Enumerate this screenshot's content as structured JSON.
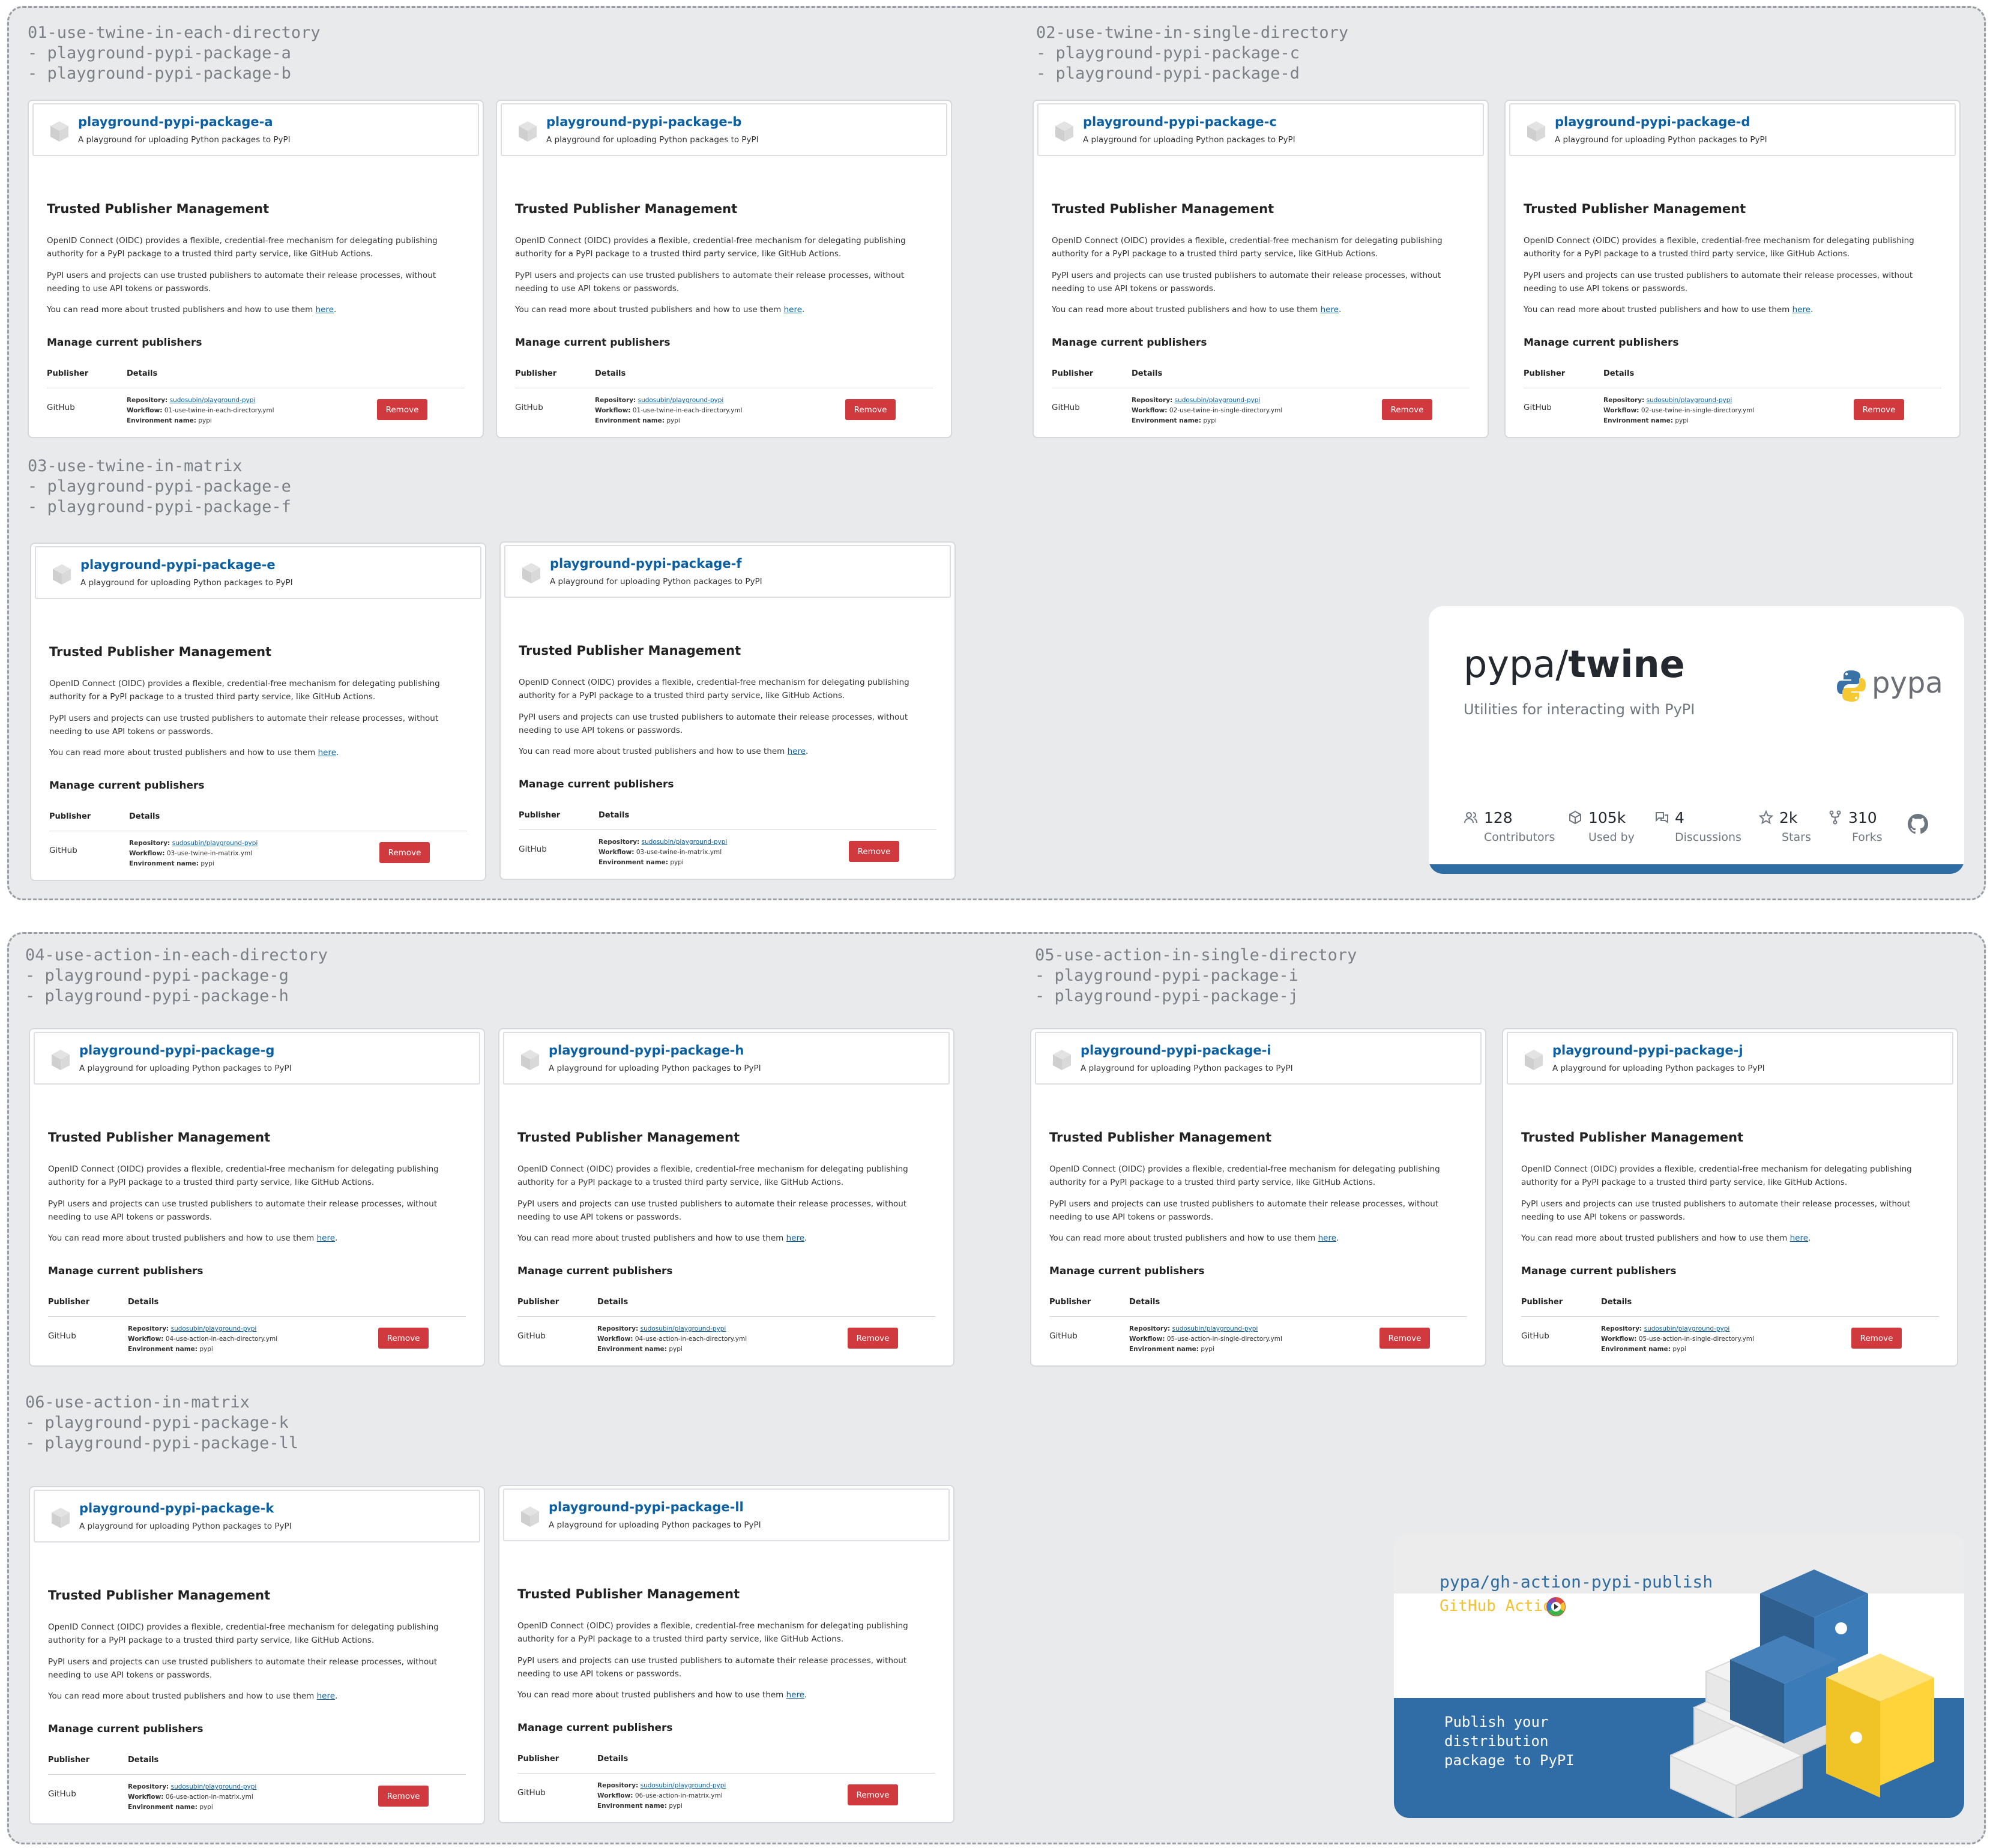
{
  "groups": [
    {
      "sections": [
        {
          "label": "01-use-twine-in-each-directory\n- playground-pypi-package-a\n- playground-pypi-package-b",
          "cards": [
            {
              "package": "playground-pypi-package-a",
              "workflow": "01-use-twine-in-each-directory.yml"
            },
            {
              "package": "playground-pypi-package-b",
              "workflow": "01-use-twine-in-each-directory.yml"
            }
          ]
        },
        {
          "label": "02-use-twine-in-single-directory\n- playground-pypi-package-c\n- playground-pypi-package-d",
          "cards": [
            {
              "package": "playground-pypi-package-c",
              "workflow": "02-use-twine-in-single-directory.yml"
            },
            {
              "package": "playground-pypi-package-d",
              "workflow": "02-use-twine-in-single-directory.yml"
            }
          ]
        },
        {
          "label": "03-use-twine-in-matrix\n- playground-pypi-package-e\n- playground-pypi-package-f",
          "cards": [
            {
              "package": "playground-pypi-package-e",
              "workflow": "03-use-twine-in-matrix.yml"
            },
            {
              "package": "playground-pypi-package-f",
              "workflow": "03-use-twine-in-matrix.yml"
            }
          ]
        }
      ]
    },
    {
      "sections": [
        {
          "label": "04-use-action-in-each-directory\n- playground-pypi-package-g\n- playground-pypi-package-h",
          "cards": [
            {
              "package": "playground-pypi-package-g",
              "workflow": "04-use-action-in-each-directory.yml"
            },
            {
              "package": "playground-pypi-package-h",
              "workflow": "04-use-action-in-each-directory.yml"
            }
          ]
        },
        {
          "label": "05-use-action-in-single-directory\n- playground-pypi-package-i\n- playground-pypi-package-j",
          "cards": [
            {
              "package": "playground-pypi-package-i",
              "workflow": "05-use-action-in-single-directory.yml"
            },
            {
              "package": "playground-pypi-package-j",
              "workflow": "05-use-action-in-single-directory.yml"
            }
          ]
        },
        {
          "label": "06-use-action-in-matrix\n- playground-pypi-package-k\n- playground-pypi-package-ll",
          "cards": [
            {
              "package": "playground-pypi-package-k",
              "workflow": "06-use-action-in-matrix.yml"
            },
            {
              "package": "playground-pypi-package-ll",
              "workflow": "06-use-action-in-matrix.yml"
            }
          ]
        }
      ]
    }
  ],
  "card_common": {
    "subtitle": "A playground for uploading Python packages to PyPI",
    "heading": "Trusted Publisher Management",
    "para1": "OpenID Connect (OIDC) provides a flexible, credential-free mechanism for delegating publishing authority for a PyPI package to a trusted third party service, like GitHub Actions.",
    "para2": "PyPI users and projects can use trusted publishers to automate their release processes, without needing to use API tokens or passwords.",
    "para3_prefix": "You can read more about trusted publishers and how to use them ",
    "para3_link": "here",
    "para3_suffix": ".",
    "manage_heading": "Manage current publishers",
    "col_publisher": "Publisher",
    "col_details": "Details",
    "publisher": "GitHub",
    "repository_label": "Repository:",
    "repository": "sudosubin/playground-pypi",
    "workflow_label": "Workflow:",
    "environment_label": "Environment name:",
    "environment": "pypi",
    "remove_label": "Remove"
  },
  "twine_card": {
    "owner": "pypa/",
    "repo": "twine",
    "description": "Utilities for interacting with PyPI",
    "org_text": "pypa",
    "stats": [
      {
        "icon": "contributors-icon",
        "value": "128",
        "label": "Contributors"
      },
      {
        "icon": "used-by-icon",
        "value": "105k",
        "label": "Used by"
      },
      {
        "icon": "discussions-icon",
        "value": "4",
        "label": "Discussions"
      },
      {
        "icon": "star-icon",
        "value": "2k",
        "label": "Stars"
      },
      {
        "icon": "fork-icon",
        "value": "310",
        "label": "Forks"
      }
    ],
    "accent_color": "#2e6da4"
  },
  "action_card": {
    "repo": "pypa/gh-action-pypi-publish",
    "badge": "GitHub Action",
    "tagline": "Publish your\ndistribution\npackage to PyPI",
    "colors": {
      "blue": "#306da6",
      "yellow": "#ffd43b"
    }
  }
}
